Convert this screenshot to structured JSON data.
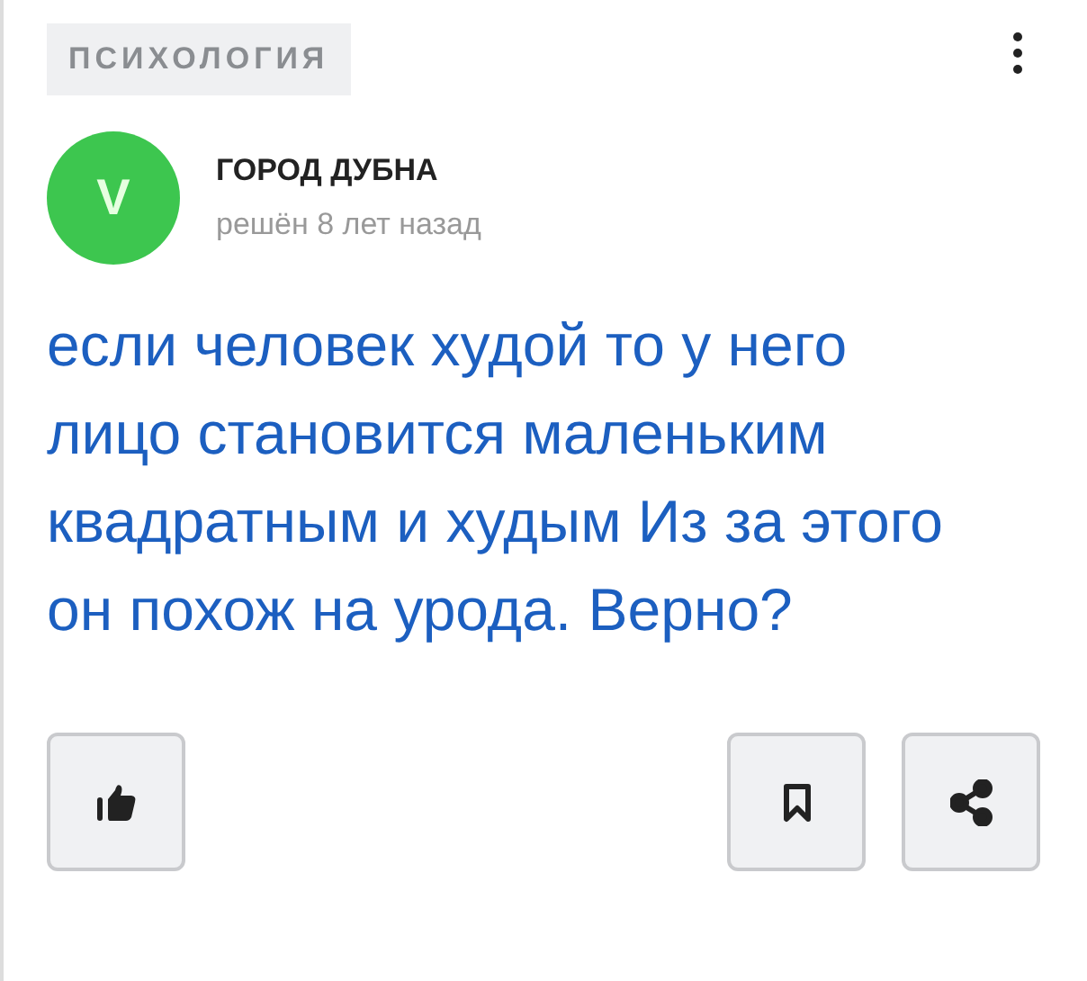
{
  "category": "ПСИХОЛОГИЯ",
  "author": {
    "name": "ГОРОД ДУБНА",
    "initial": "V",
    "color": "#3dc64f",
    "meta": "решён 8 лет назад"
  },
  "question": "если человек худой то у него лицо становится маленьким квадратным и худым Из за этого он похож на урода. Верно?",
  "actions": [
    {
      "kind": "like"
    },
    {
      "kind": "bookmark"
    },
    {
      "kind": "share"
    }
  ]
}
